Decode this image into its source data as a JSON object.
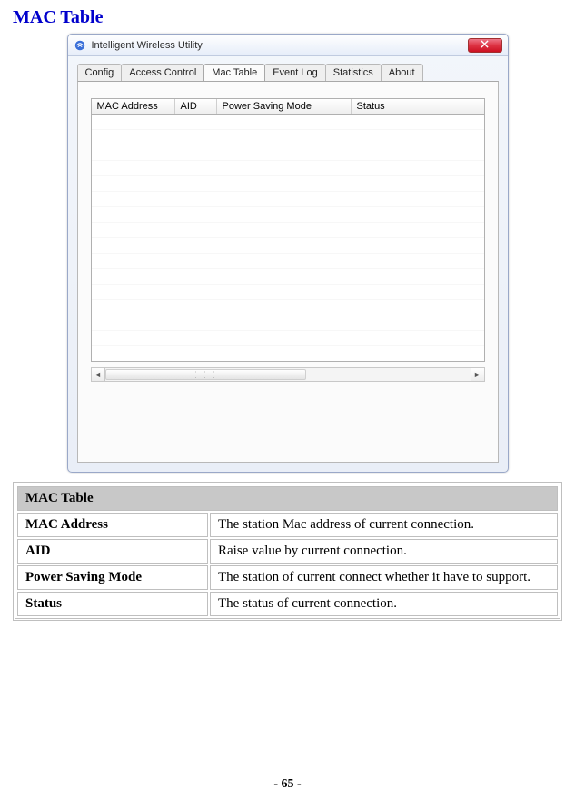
{
  "page_title": "MAC Table",
  "app": {
    "title": "Intelligent Wireless Utility",
    "tabs": [
      {
        "label": "Config",
        "active": false
      },
      {
        "label": "Access Control",
        "active": false
      },
      {
        "label": "Mac Table",
        "active": true
      },
      {
        "label": "Event Log",
        "active": false
      },
      {
        "label": "Statistics",
        "active": false
      },
      {
        "label": "About",
        "active": false
      }
    ],
    "columns": {
      "mac": "MAC Address",
      "aid": "AID",
      "psm": "Power Saving Mode",
      "status": "Status"
    }
  },
  "desc": {
    "section_title": "MAC Table",
    "rows": [
      {
        "term": "MAC Address",
        "def": "The station Mac address of current connection."
      },
      {
        "term": "AID",
        "def": "Raise value by current connection."
      },
      {
        "term": "Power Saving Mode",
        "def": "The station of current connect whether it have to support."
      },
      {
        "term": "Status",
        "def": "The status of current connection."
      }
    ]
  },
  "page_number": "- 65 -"
}
